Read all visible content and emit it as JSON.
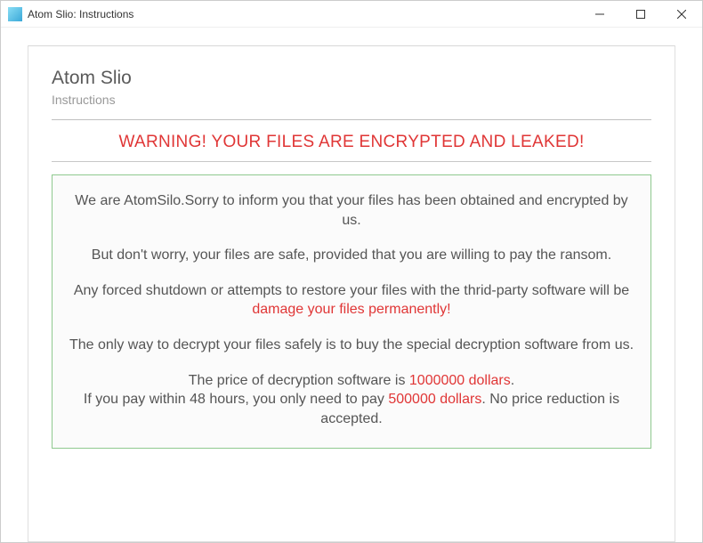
{
  "window": {
    "title": "Atom Slio: Instructions"
  },
  "document": {
    "title": "Atom Slio",
    "subtitle": "Instructions",
    "warning": "WARNING! YOUR FILES ARE ENCRYPTED AND LEAKED!",
    "p1": "We are AtomSilo.Sorry to inform you that your files has been obtained and encrypted by us.",
    "p2": "But don't worry, your files are safe, provided that you are willing to pay the ransom.",
    "p3a": "Any forced shutdown or attempts to restore your files with the thrid-party software will be ",
    "p3b": "damage your files permanently!",
    "p4": "The only way to decrypt your files safely is to buy the special decryption software from us.",
    "p5a": "The price of decryption software is ",
    "p5b": "1000000 dollars",
    "p5c": ".",
    "p6a": "If you pay within 48 hours, you only need to pay ",
    "p6b": "500000 dollars",
    "p6c": ". No price reduction is accepted."
  }
}
